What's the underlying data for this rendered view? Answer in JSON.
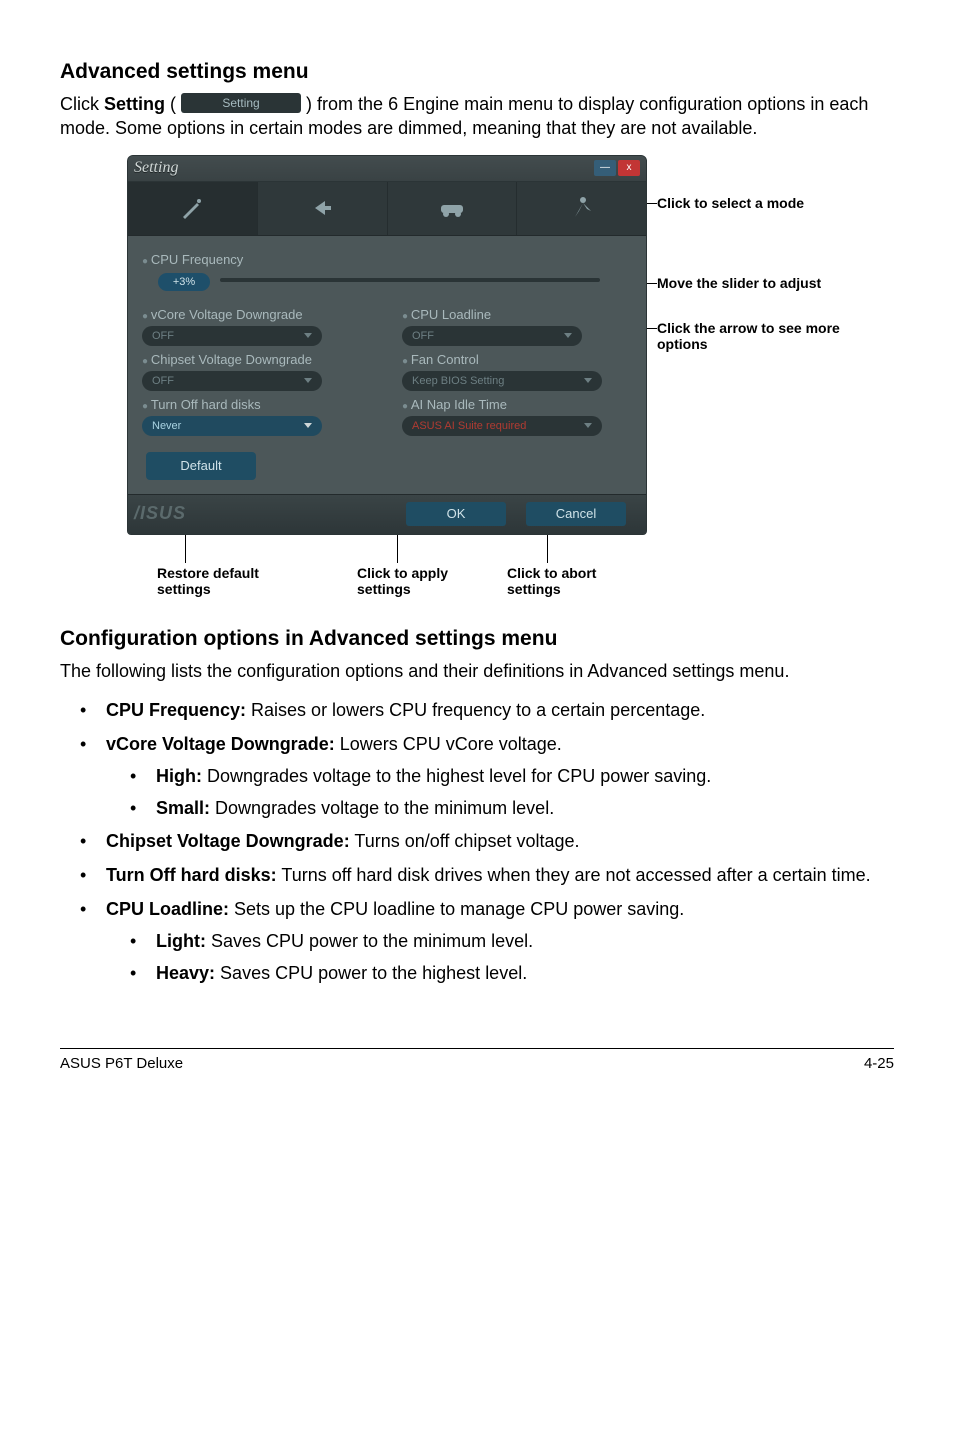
{
  "section1_title": "Advanced settings menu",
  "section1_para_pre": "Click ",
  "section1_para_bold": "Setting",
  "section1_para_paren": " (",
  "inline_setting_label": "Setting",
  "section1_para_post": ") from the 6 Engine main menu to display configuration options in each mode. Some options in certain modes are dimmed, meaning that they are not available.",
  "window": {
    "title": "Setting",
    "minimize": "—",
    "close": "x",
    "cpu_freq_label": "CPU Frequency",
    "slider_value": "+3%",
    "left": {
      "vcore_label": "vCore Voltage Downgrade",
      "vcore_value": "OFF",
      "chipset_label": "Chipset Voltage Downgrade",
      "chipset_value": "OFF",
      "hdd_label": "Turn Off hard disks",
      "hdd_value": "Never"
    },
    "right": {
      "loadline_label": "CPU Loadline",
      "loadline_value": "OFF",
      "fan_label": "Fan Control",
      "fan_value": "Keep BIOS Setting",
      "nap_label": "AI Nap Idle Time",
      "nap_value": "ASUS AI Suite required"
    },
    "default_btn": "Default",
    "ok_btn": "OK",
    "cancel_btn": "Cancel",
    "logo": "/ISUS"
  },
  "callouts": {
    "select_mode": "Click to select a mode",
    "move_slider": "Move the slider to adjust",
    "click_arrow": "Click the arrow to see more options",
    "restore": "Restore default settings",
    "apply": "Click to apply settings",
    "abort": "Click to abort settings"
  },
  "section2_title": "Configuration options in Advanced settings menu",
  "section2_para": "The following lists the configuration options and their definitions in Advanced settings menu.",
  "bullets": {
    "cpu_freq_b": "CPU Frequency:",
    "cpu_freq_t": " Raises or lowers CPU frequency to a certain percentage.",
    "vcore_b": "vCore Voltage Downgrade:",
    "vcore_t": " Lowers CPU vCore voltage.",
    "high_b": "High:",
    "high_t": " Downgrades voltage to the highest level for CPU power saving.",
    "small_b": "Small:",
    "small_t": " Downgrades voltage to the minimum level.",
    "chipset_b": "Chipset Voltage Downgrade:",
    "chipset_t": " Turns on/off chipset voltage.",
    "hdd_b": "Turn Off hard disks:",
    "hdd_t": " Turns off hard disk drives when they are not accessed after a certain time.",
    "loadline_b": "CPU Loadline:",
    "loadline_t": " Sets up the CPU loadline to manage CPU power saving.",
    "light_b": "Light:",
    "light_t": " Saves CPU power to the minimum level.",
    "heavy_b": "Heavy:",
    "heavy_t": " Saves CPU power to the highest level."
  },
  "footer_left": "ASUS P6T Deluxe",
  "footer_right": "4-25"
}
